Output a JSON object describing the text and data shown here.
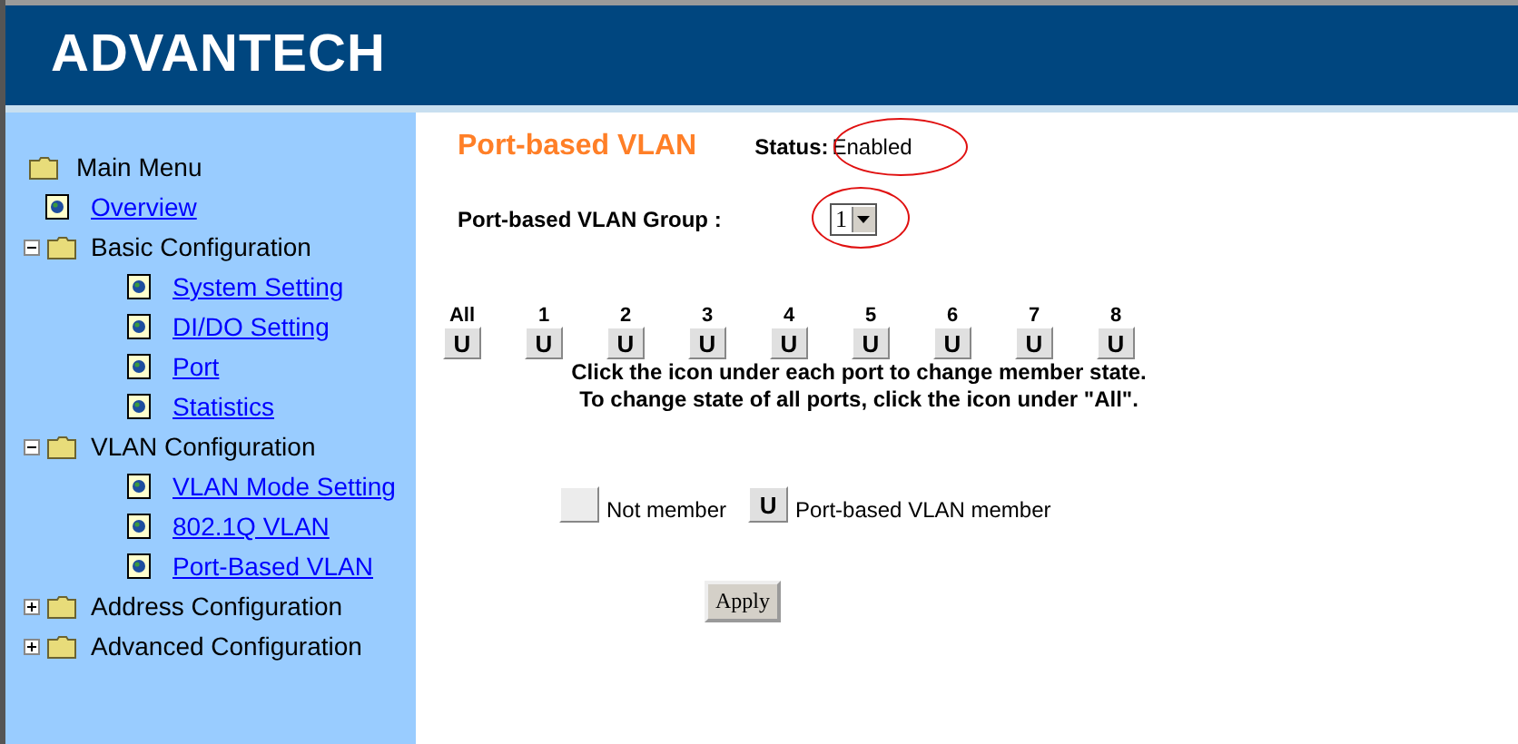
{
  "header": {
    "logo": "ADVANTECH"
  },
  "sidebar": {
    "root": "Main Menu",
    "items": [
      {
        "label": "Overview",
        "kind": "page"
      },
      {
        "label": "Basic Configuration",
        "kind": "folder",
        "expanded": true,
        "children": [
          {
            "label": "System Setting",
            "kind": "page"
          },
          {
            "label": "DI/DO Setting",
            "kind": "page"
          },
          {
            "label": "Port",
            "kind": "page"
          },
          {
            "label": "Statistics",
            "kind": "page"
          }
        ]
      },
      {
        "label": "VLAN Configuration",
        "kind": "folder",
        "expanded": true,
        "children": [
          {
            "label": "VLAN Mode Setting",
            "kind": "page"
          },
          {
            "label": "802.1Q VLAN",
            "kind": "page"
          },
          {
            "label": "Port-Based VLAN",
            "kind": "page"
          }
        ]
      },
      {
        "label": "Address Configuration",
        "kind": "folder",
        "expanded": false
      },
      {
        "label": "Advanced Configuration",
        "kind": "folder",
        "expanded": false
      }
    ]
  },
  "main": {
    "title": "Port-based VLAN",
    "status_label": "Status:",
    "status_value": "Enabled",
    "status_highlighted": true,
    "group_label": "Port-based VLAN Group :",
    "group_value": "1",
    "group_highlighted": true,
    "ports": [
      {
        "label": "All",
        "member": true,
        "mark": "U"
      },
      {
        "label": "1",
        "member": true,
        "mark": "U"
      },
      {
        "label": "2",
        "member": true,
        "mark": "U"
      },
      {
        "label": "3",
        "member": true,
        "mark": "U"
      },
      {
        "label": "4",
        "member": true,
        "mark": "U"
      },
      {
        "label": "5",
        "member": true,
        "mark": "U"
      },
      {
        "label": "6",
        "member": true,
        "mark": "U"
      },
      {
        "label": "7",
        "member": true,
        "mark": "U"
      },
      {
        "label": "8",
        "member": true,
        "mark": "U"
      }
    ],
    "instructions": [
      "Click the icon under each port to change member state.",
      "To change state of all ports, click the icon under \"All\"."
    ],
    "legend": [
      {
        "member": false,
        "label": "Not member"
      },
      {
        "member": true,
        "mark": "U",
        "label": "Port-based VLAN member"
      }
    ],
    "apply_button": "Apply"
  }
}
